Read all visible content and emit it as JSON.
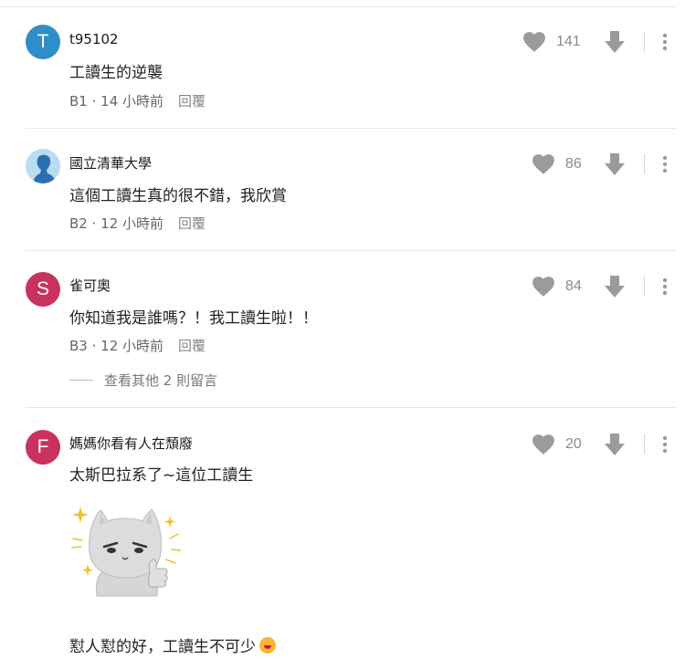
{
  "comments": [
    {
      "avatar_letter": "T",
      "avatar_color": "#2f8ec7",
      "name": "t95102",
      "text": "工讀生的逆襲",
      "floor": "B1",
      "time": "14 小時前",
      "reply": "回覆",
      "likes": "141"
    },
    {
      "avatar_letter": "",
      "avatar_color": "#b9dcf3",
      "name": "國立清華大學",
      "text": "這個工讀生真的很不錯，我欣賞",
      "floor": "B2",
      "time": "12 小時前",
      "reply": "回覆",
      "likes": "86"
    },
    {
      "avatar_letter": "S",
      "avatar_color": "#c8325c",
      "name": "雀可奧",
      "text": "你知道我是誰嗎？！我工讀生啦！！",
      "floor": "B3",
      "time": "12 小時前",
      "reply": "回覆",
      "likes": "84",
      "more_replies": "查看其他 2 則留言"
    },
    {
      "avatar_letter": "F",
      "avatar_color": "#c8325c",
      "name": "媽媽你看有人在頹廢",
      "text": "太斯巴拉系了~這位工讀生",
      "text2": "懟人懟的好，工讀生不可少",
      "likes": "20"
    }
  ],
  "meta_sep": " · ",
  "colors": {
    "icon_gray": "#9b9b9b",
    "divider": "#e6e6e6"
  },
  "icons": [
    "heart-icon",
    "downvote-icon",
    "more-vert-icon",
    "sticker-image",
    "emoji-icon"
  ]
}
